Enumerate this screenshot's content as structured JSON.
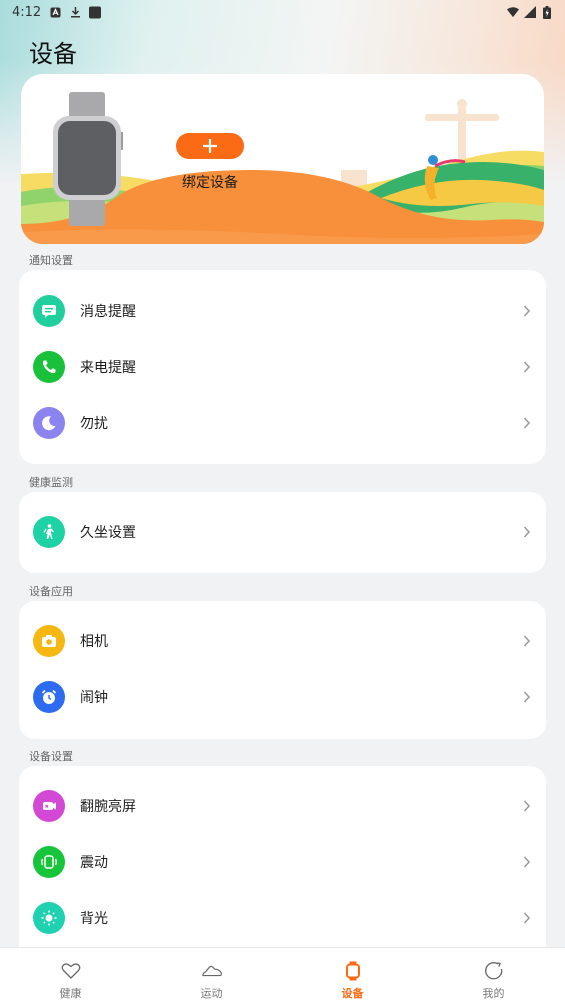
{
  "status_bar": {
    "time": "4:12",
    "left_icons": [
      "a-icon",
      "download-icon",
      "square-icon"
    ],
    "right_icons": [
      "wifi-icon",
      "signal-icon",
      "battery-icon"
    ]
  },
  "page": {
    "title": "设备"
  },
  "banner": {
    "bind_button_label": "+",
    "bind_label": "绑定设备",
    "accent_color": "#fb6a14"
  },
  "sections": [
    {
      "label": "通知设置",
      "items": [
        {
          "label": "消息提醒",
          "icon": "message-icon",
          "color": "#1fcf9e"
        },
        {
          "label": "来电提醒",
          "icon": "phone-icon",
          "color": "#19c13a"
        },
        {
          "label": "勿扰",
          "icon": "moon-icon",
          "color": "#8a83f0"
        }
      ]
    },
    {
      "label": "健康监测",
      "items": [
        {
          "label": "久坐设置",
          "icon": "walking-icon",
          "color": "#1dd2a4"
        }
      ]
    },
    {
      "label": "设备应用",
      "items": [
        {
          "label": "相机",
          "icon": "camera-icon",
          "color": "#f6b810"
        },
        {
          "label": "闹钟",
          "icon": "alarm-icon",
          "color": "#2d6cf0"
        }
      ]
    },
    {
      "label": "设备设置",
      "items": [
        {
          "label": "翻腕亮屏",
          "icon": "wrist-raise-icon",
          "color": "#d448d6"
        },
        {
          "label": "震动",
          "icon": "vibration-icon",
          "color": "#16c53a"
        },
        {
          "label": "背光",
          "icon": "brightness-icon",
          "color": "#1fd1b0"
        }
      ]
    }
  ],
  "tabs": [
    {
      "label": "健康",
      "icon": "heart-icon",
      "active": false
    },
    {
      "label": "运动",
      "icon": "sneaker-icon",
      "active": false
    },
    {
      "label": "设备",
      "icon": "watch-icon",
      "active": true
    },
    {
      "label": "我的",
      "icon": "profile-icon",
      "active": false
    }
  ]
}
